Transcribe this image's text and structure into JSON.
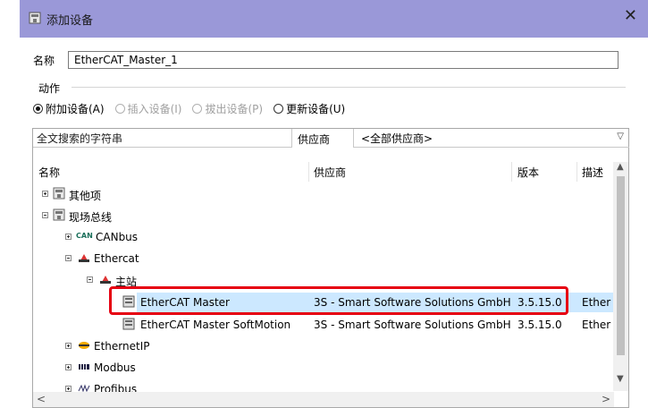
{
  "window": {
    "title": "添加设备",
    "close_glyph": "✕"
  },
  "name_label": "名称",
  "name_value": "EtherCAT_Master_1",
  "action_group_label": "动作",
  "actions": [
    {
      "label": "附加设备(A)",
      "selected": true,
      "enabled": true
    },
    {
      "label": "插入设备(I)",
      "selected": false,
      "enabled": false
    },
    {
      "label": "拔出设备(P)",
      "selected": false,
      "enabled": false
    },
    {
      "label": "更新设备(U)",
      "selected": false,
      "enabled": true
    }
  ],
  "search": {
    "placeholder": "全文搜索的字符串"
  },
  "vendor": {
    "label": "供应商",
    "selected": "<全部供应商>",
    "chevron_icon": "chevron-down-icon"
  },
  "columns": {
    "name": "名称",
    "vendor": "供应商",
    "version": "版本",
    "desc": "描述"
  },
  "tree": [
    {
      "name": "其他项",
      "expander": "+",
      "icon": "device-folder-icon"
    },
    {
      "name": "现场总线",
      "expander": "-",
      "icon": "device-folder-icon"
    },
    {
      "name": "CANbus",
      "expander": "+",
      "icon": "can-icon",
      "icon_text": "CAN"
    },
    {
      "name": "Ethercat",
      "expander": "-",
      "icon": "ethercat-icon"
    },
    {
      "name": "主站",
      "expander": "-",
      "icon": "ethercat-icon"
    },
    {
      "name": "EtherCAT Master",
      "vendor": "3S - Smart Software Solutions GmbH",
      "version": "3.5.15.0",
      "desc": "Ether",
      "icon": "device-icon",
      "selected": true
    },
    {
      "name": "EtherCAT Master SoftMotion",
      "vendor": "3S - Smart Software Solutions GmbH",
      "version": "3.5.15.0",
      "desc": "Ether",
      "icon": "device-icon"
    },
    {
      "name": "EthernetIP",
      "expander": "+",
      "icon": "ethernetip-icon"
    },
    {
      "name": "Modbus",
      "expander": "+",
      "icon": "modbus-icon"
    },
    {
      "name": "Profibus",
      "expander": "+",
      "icon": "profibus-icon"
    }
  ],
  "colors": {
    "titlebar": "#9a98d8",
    "selection": "#cce8ff",
    "highlight_box": "#e60012"
  }
}
